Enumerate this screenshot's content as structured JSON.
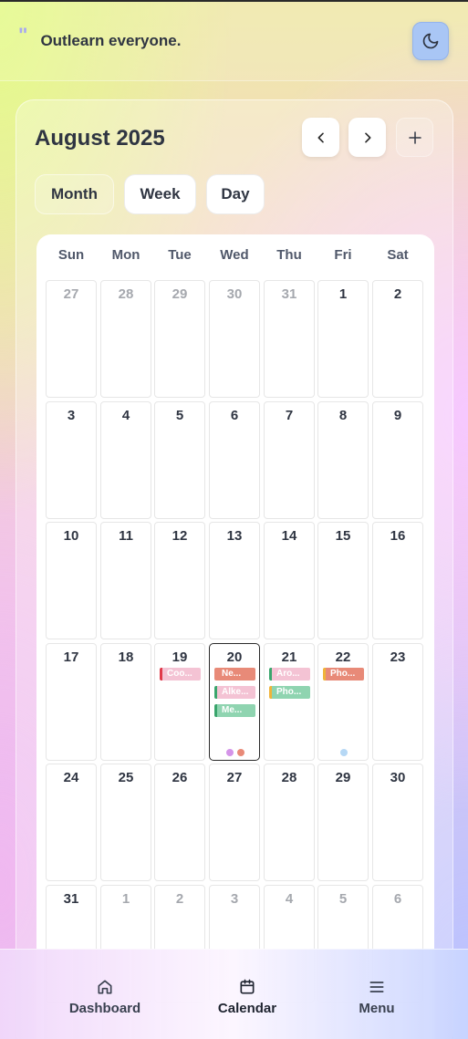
{
  "header": {
    "quote_mark": "\"",
    "tagline": "Outlearn everyone."
  },
  "calendar": {
    "title": "August 2025",
    "views": [
      "Month",
      "Week",
      "Day"
    ],
    "active_view": "Month",
    "weekdays": [
      "Sun",
      "Mon",
      "Tue",
      "Wed",
      "Thu",
      "Fri",
      "Sat"
    ],
    "weeks": [
      [
        {
          "n": "27",
          "other": true
        },
        {
          "n": "28",
          "other": true
        },
        {
          "n": "29",
          "other": true
        },
        {
          "n": "30",
          "other": true
        },
        {
          "n": "31",
          "other": true
        },
        {
          "n": "1"
        },
        {
          "n": "2"
        }
      ],
      [
        {
          "n": "3"
        },
        {
          "n": "4"
        },
        {
          "n": "5"
        },
        {
          "n": "6"
        },
        {
          "n": "7"
        },
        {
          "n": "8"
        },
        {
          "n": "9"
        }
      ],
      [
        {
          "n": "10"
        },
        {
          "n": "11"
        },
        {
          "n": "12"
        },
        {
          "n": "13"
        },
        {
          "n": "14"
        },
        {
          "n": "15"
        },
        {
          "n": "16"
        }
      ],
      [
        {
          "n": "17"
        },
        {
          "n": "18"
        },
        {
          "n": "19",
          "events": [
            {
              "label": "Coo...",
              "color": "#f4c3d4",
              "bar": "#e03a4a"
            }
          ]
        },
        {
          "n": "20",
          "today": true,
          "events": [
            {
              "label": "Ne...",
              "color": "#e88a78",
              "bar": "#e88a78"
            },
            {
              "label": "Alke...",
              "color": "#f4c3d4",
              "bar": "#3aa56c"
            },
            {
              "label": "Me...",
              "color": "#8fd4b0",
              "bar": "#3aa56c"
            }
          ],
          "dots": [
            "#d494e8",
            "#e88a78"
          ]
        },
        {
          "n": "21",
          "events": [
            {
              "label": "Aro...",
              "color": "#f4c3d4",
              "bar": "#3aa56c"
            },
            {
              "label": "Pho...",
              "color": "#8fd4b0",
              "bar": "#f0b43a"
            }
          ]
        },
        {
          "n": "22",
          "events": [
            {
              "label": "Pho...",
              "color": "#e88a78",
              "bar": "#f0b43a"
            }
          ],
          "dots": [
            "#b6d8f5"
          ]
        },
        {
          "n": "23"
        }
      ],
      [
        {
          "n": "24"
        },
        {
          "n": "25"
        },
        {
          "n": "26"
        },
        {
          "n": "27"
        },
        {
          "n": "28"
        },
        {
          "n": "29"
        },
        {
          "n": "30"
        }
      ],
      [
        {
          "n": "31"
        },
        {
          "n": "1",
          "other": true
        },
        {
          "n": "2",
          "other": true
        },
        {
          "n": "3",
          "other": true
        },
        {
          "n": "4",
          "other": true
        },
        {
          "n": "5",
          "other": true
        },
        {
          "n": "6",
          "other": true
        }
      ]
    ]
  },
  "bottom_nav": {
    "items": [
      {
        "label": "Dashboard",
        "icon": "home-icon"
      },
      {
        "label": "Calendar",
        "icon": "calendar-icon",
        "active": true
      },
      {
        "label": "Menu",
        "icon": "menu-icon"
      }
    ]
  }
}
